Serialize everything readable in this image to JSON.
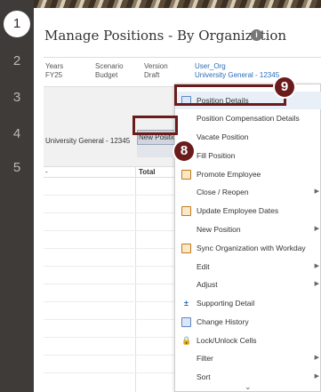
{
  "rail": {
    "steps": [
      "1",
      "2",
      "3",
      "4",
      "5"
    ],
    "active": "1"
  },
  "page": {
    "title": "Manage Positions - By Organization"
  },
  "pov": [
    {
      "label": "Years",
      "value": "FY25"
    },
    {
      "label": "Scenario",
      "value": "Budget"
    },
    {
      "label": "Version",
      "value": "Draft"
    },
    {
      "label": "User_Org",
      "value": "University General - 12345"
    }
  ],
  "grid": {
    "row_label": "University General - 12345",
    "selected_cell": "New Position",
    "row2_label": "-",
    "total_label": "Total"
  },
  "context_menu": {
    "items": [
      {
        "label": "Position Details",
        "icon": "position-details-icon",
        "submenu": false
      },
      {
        "label": "Position Compensation Details",
        "icon": "",
        "submenu": false
      },
      {
        "label": "Vacate Position",
        "icon": "",
        "submenu": false
      },
      {
        "label": "Fill Position",
        "icon": "",
        "submenu": false
      },
      {
        "label": "Promote Employee",
        "icon": "promote-icon",
        "submenu": false
      },
      {
        "label": "Close / Reopen",
        "icon": "",
        "submenu": true
      },
      {
        "label": "Update Employee Dates",
        "icon": "update-dates-icon",
        "submenu": false
      },
      {
        "label": "New Position",
        "icon": "",
        "submenu": true
      },
      {
        "label": "Sync Organization with Workday",
        "icon": "sync-icon",
        "submenu": false
      },
      {
        "label": "Edit",
        "icon": "",
        "submenu": true
      },
      {
        "label": "Adjust",
        "icon": "",
        "submenu": true
      },
      {
        "label": "Supporting Detail",
        "icon": "supporting-detail-icon",
        "submenu": false
      },
      {
        "label": "Change History",
        "icon": "change-history-icon",
        "submenu": false
      },
      {
        "label": "Lock/Unlock Cells",
        "icon": "lock-icon",
        "submenu": false
      },
      {
        "label": "Filter",
        "icon": "",
        "submenu": true
      },
      {
        "label": "Sort",
        "icon": "",
        "submenu": true
      }
    ]
  },
  "callouts": {
    "step9": "9",
    "step8": "8"
  },
  "colors": {
    "rail": "#3f3b38",
    "callout": "#6a1b1b",
    "link": "#2a6db5",
    "menu_highlight": "#e8eff7"
  }
}
